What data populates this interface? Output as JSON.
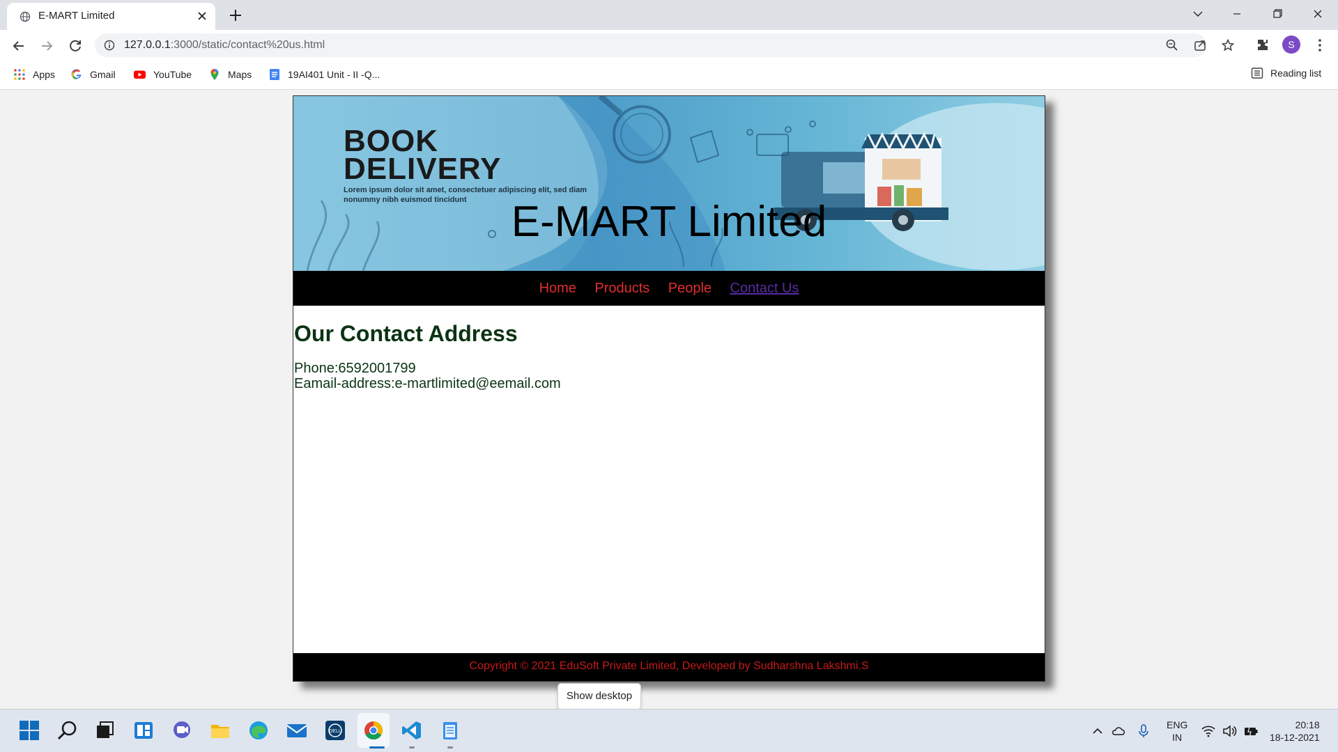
{
  "browser": {
    "tab_title": "E-MART Limited",
    "url_host": "127.0.0.1",
    "url_path": ":3000/static/contact%20us.html",
    "avatar_letter": "S",
    "bookmarks": [
      {
        "label": "Apps",
        "icon": "apps-grid-icon"
      },
      {
        "label": "Gmail",
        "icon": "google-icon"
      },
      {
        "label": "YouTube",
        "icon": "youtube-icon"
      },
      {
        "label": "Maps",
        "icon": "maps-icon"
      },
      {
        "label": "19AI401 Unit - II -Q...",
        "icon": "docs-icon"
      }
    ],
    "reading_list": "Reading list"
  },
  "page": {
    "site_title": "E-MART Limited",
    "banner": {
      "headline_line1": "BOOK",
      "headline_line2": "DELIVERY",
      "subtext": "Lorem ipsum dolor sit amet, consectetuer adipiscing elit, sed diam nonummy nibh euismod tincidunt"
    },
    "nav": [
      {
        "label": "Home"
      },
      {
        "label": "Products"
      },
      {
        "label": "People"
      },
      {
        "label": "Contact Us",
        "active": true
      }
    ],
    "contact": {
      "heading": "Our Contact Address",
      "phone": "Phone:6592001799",
      "email": "Eamail-address:e-martlimited@eemail.com"
    },
    "footer": "Copyright © 2021 EduSoft Private Limited, Developed by Sudharshna Lakshmi.S"
  },
  "tooltip": "Show desktop",
  "taskbar": {
    "lang_line1": "ENG",
    "lang_line2": "IN",
    "time": "20:18",
    "date": "18-12-2021"
  },
  "colors": {
    "nav_link": "#e02f2f",
    "nav_active": "#5a2ba4",
    "heading_text": "#0b3313",
    "footer_text": "#c51a1a"
  }
}
